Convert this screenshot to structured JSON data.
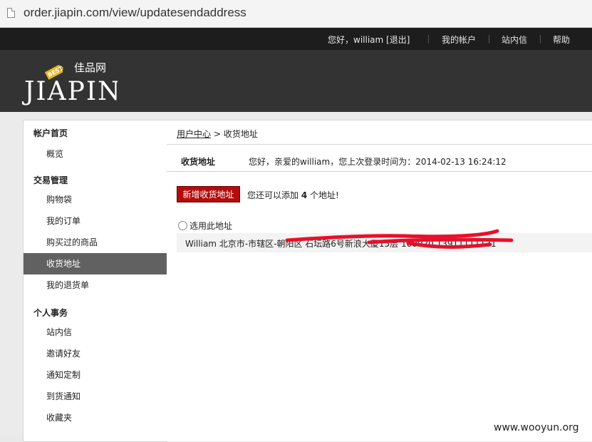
{
  "browser": {
    "url": "order.jiapin.com/view/updatesendaddress"
  },
  "topnav": {
    "greeting": "您好，william [退出]",
    "my_account": "我的帐户",
    "messages": "站内信",
    "help": "帮助"
  },
  "logo": {
    "brand_cn": "佳品网",
    "brand_en": "JIAPIN",
    "tag": "BEST"
  },
  "sidebar": {
    "sections": [
      {
        "title": "帐户首页",
        "items": [
          "概览"
        ]
      },
      {
        "title": "交易管理",
        "items": [
          "购物袋",
          "我的订单",
          "购买过的商品",
          "收货地址",
          "我的退货单"
        ]
      },
      {
        "title": "个人事务",
        "items": [
          "站内信",
          "邀请好友",
          "通知定制",
          "到货通知",
          "收藏夹"
        ]
      }
    ],
    "active_item": "收货地址"
  },
  "breadcrumb": {
    "link": "用户中心",
    "rest": "> 收货地址"
  },
  "info": {
    "title": "收货地址",
    "greeting": "您好，亲爱的william，您上次登录时间为：2014-02-13 16:24:12"
  },
  "actions": {
    "add_button": "新增收货地址",
    "note_prefix": "您还可以添加",
    "note_count": "4",
    "note_suffix": "个地址!"
  },
  "address": {
    "select_label": "选用此地址",
    "text": "William 北京市-市辖区-朝阳区 石坛路6号新浪大厦15层 100020 13911111131"
  },
  "watermark": "www.wooyun.org",
  "colors": {
    "topnav_bg": "#1d1d1d",
    "header_bg": "#333333",
    "active_bg": "#616161",
    "button_red": "#b40c0c",
    "redact": "#e8102a"
  }
}
